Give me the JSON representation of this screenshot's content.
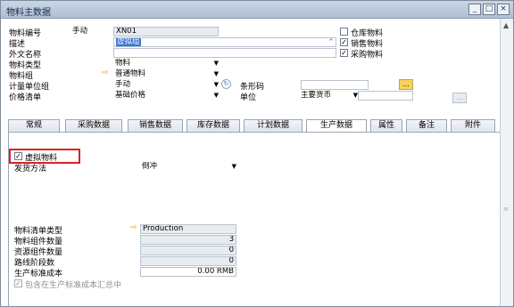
{
  "window": {
    "title": "物料主数据",
    "buttons": [
      "_",
      "□",
      "×"
    ]
  },
  "header": {
    "item_no_label": "物料编号",
    "item_no_mode": "手动",
    "item_no_value": "XN01",
    "desc_label": "描述",
    "desc_value": "虚拟组",
    "foreign_name_label": "外文名称",
    "item_type_label": "物料类型",
    "item_type_value": "物料",
    "item_group_label": "物料组",
    "item_group_value": "普通物料",
    "uom_group_label": "计量单位组",
    "uom_group_value": "手动",
    "price_list_label": "价格清单",
    "price_list_value": "基础价格",
    "barcode_label": "条形码",
    "unit_label": "单位",
    "unit_currency_value": "主要货币",
    "inventory_item_label": "仓库物料",
    "sales_item_label": "销售物料",
    "purchase_item_label": "采购物料",
    "inventory_item_checked": false,
    "sales_item_checked": true,
    "purchase_item_checked": true,
    "ellipsis": "..."
  },
  "tabs": [
    "常规",
    "采购数据",
    "销售数据",
    "库存数据",
    "计划数据",
    "生产数据",
    "属性",
    "备注",
    "附件"
  ],
  "active_tab": "生产数据",
  "production": {
    "phantom_label": "虚拟物料",
    "phantom_checked": true,
    "issue_method_label": "发货方法",
    "issue_method_value": "倒冲",
    "bom_type_label": "物料清单类型",
    "bom_type_value": "Production",
    "component_qty_label": "物料组件数量",
    "component_qty_value": "3",
    "resource_qty_label": "资源组件数量",
    "resource_qty_value": "0",
    "routing_stages_label": "路线阶段数",
    "routing_stages_value": "0",
    "std_cost_label": "生产标准成本",
    "std_cost_value": "0.00 RMB",
    "include_in_rollup_label": "包含在生产标准成本汇总中",
    "include_in_rollup_checked": true
  }
}
